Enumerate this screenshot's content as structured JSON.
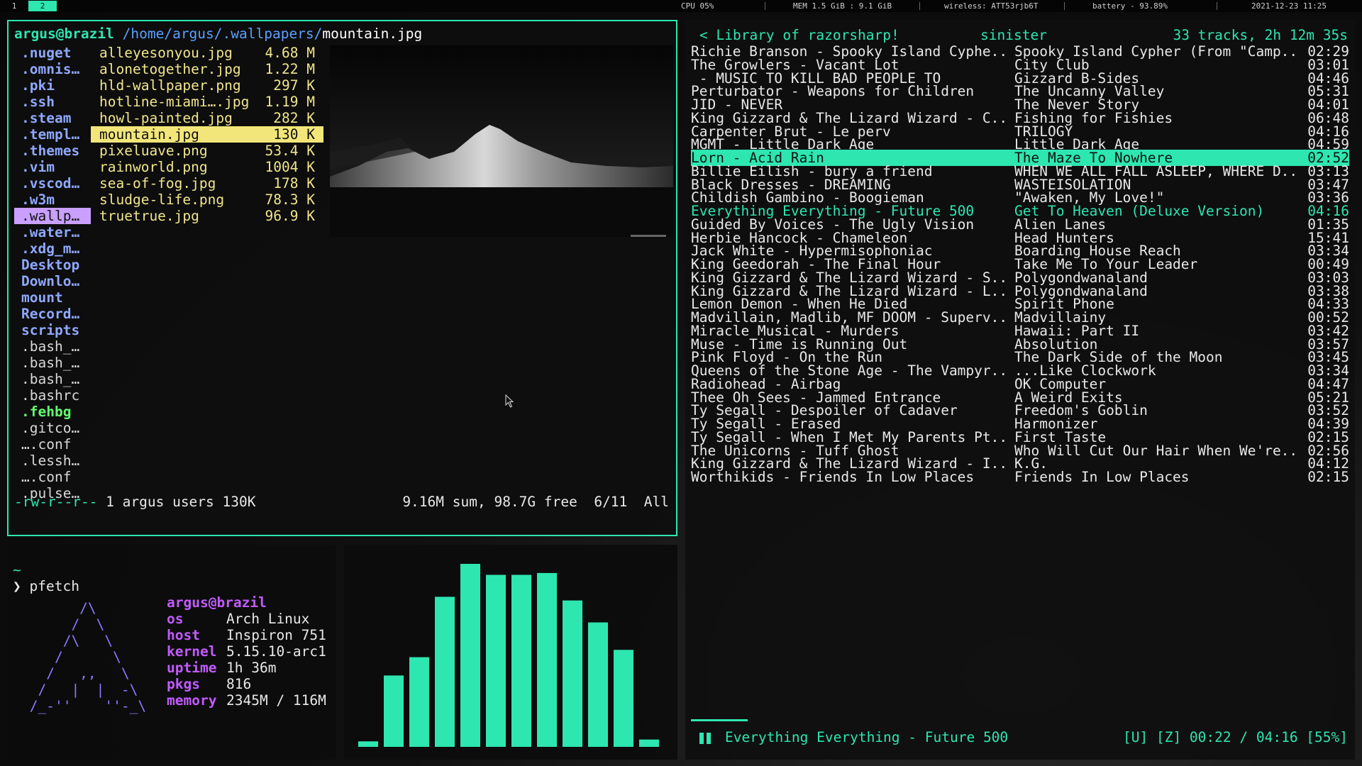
{
  "statusbar": {
    "workspaces": [
      "1",
      "2"
    ],
    "active_workspace": "2",
    "cpu": "CPU 05%",
    "mem": "MEM 1.5 GiB : 9.1 GiB",
    "wireless": "wireless: ATT53rjb6T",
    "battery": "battery - 93.89%",
    "datetime": "2021-12-23 11:25"
  },
  "ranger": {
    "user": "argus@brazil",
    "dir": "/home/argus/.wallpapers/",
    "file": "mountain.jpg",
    "left_entries": [
      {
        "name": ".nuget",
        "kind": "dir"
      },
      {
        "name": ".omnis…",
        "kind": "dir"
      },
      {
        "name": ".pki",
        "kind": "dir"
      },
      {
        "name": ".ssh",
        "kind": "dir"
      },
      {
        "name": ".steam",
        "kind": "dir"
      },
      {
        "name": ".templ…",
        "kind": "dir"
      },
      {
        "name": ".themes",
        "kind": "dir"
      },
      {
        "name": ".vim",
        "kind": "dir"
      },
      {
        "name": ".vscod…",
        "kind": "dir"
      },
      {
        "name": ".w3m",
        "kind": "dir"
      },
      {
        "name": ".wallp…",
        "kind": "sel"
      },
      {
        "name": ".water…",
        "kind": "dir"
      },
      {
        "name": ".xdg_m…",
        "kind": "dir"
      },
      {
        "name": "Desktop",
        "kind": "dir"
      },
      {
        "name": "Downlo…",
        "kind": "dir"
      },
      {
        "name": "mount",
        "kind": "dir"
      },
      {
        "name": "Record…",
        "kind": "dir"
      },
      {
        "name": "scripts",
        "kind": "dir"
      },
      {
        "name": ".bash_…",
        "kind": "file"
      },
      {
        "name": ".bash_…",
        "kind": "file"
      },
      {
        "name": ".bash_…",
        "kind": "file"
      },
      {
        "name": ".bashrc",
        "kind": "file"
      },
      {
        "name": ".fehbg",
        "kind": "exec"
      },
      {
        "name": ".gitco…",
        "kind": "file"
      },
      {
        "name": "….conf",
        "kind": "file"
      },
      {
        "name": ".lessh…",
        "kind": "file"
      },
      {
        "name": "….conf",
        "kind": "file"
      },
      {
        "name": ".pulse…",
        "kind": "file"
      }
    ],
    "files": [
      {
        "name": "alleyesonyou.jpg",
        "size": "4.68 M"
      },
      {
        "name": "alonetogether.jpg",
        "size": "1.22 M"
      },
      {
        "name": "hld-wallpaper.png",
        "size": "297 K"
      },
      {
        "name": "hotline-miami….jpg",
        "size": "1.19 M"
      },
      {
        "name": "howl-painted.jpg",
        "size": "282 K"
      },
      {
        "name": "mountain.jpg",
        "size": "130 K",
        "selected": true
      },
      {
        "name": "pixeluave.png",
        "size": "53.4 K"
      },
      {
        "name": "rainworld.png",
        "size": "1004 K"
      },
      {
        "name": "sea-of-fog.jpg",
        "size": "178 K"
      },
      {
        "name": "sludge-life.png",
        "size": "78.3 K"
      },
      {
        "name": "truetrue.jpg",
        "size": "96.9 K"
      }
    ],
    "perms": "-rw-r--r--",
    "owner": "1 argus users 130K",
    "summary": "9.16M sum, 98.7G free  6/11  All"
  },
  "cmus": {
    "header_left": "< Library of razorsharp!",
    "header_mid": "sinister",
    "header_right": "33 tracks, 2h 12m 35s",
    "tracks": [
      {
        "a": "Richie Branson - Spooky Island Cyphe..",
        "b": "Spooky Island Cypher (From \"Camp..",
        "d": "02:29"
      },
      {
        "a": "The Growlers - Vacant Lot",
        "b": "City Club",
        "d": "03:01"
      },
      {
        "a": " - MUSIC TO KILL BAD PEOPLE TO",
        "b": "Gizzard B-Sides",
        "d": "04:46"
      },
      {
        "a": "Perturbator - Weapons for Children",
        "b": "The Uncanny Valley",
        "d": "05:31"
      },
      {
        "a": "JID - NEVER",
        "b": "The Never Story",
        "d": "04:01"
      },
      {
        "a": "King Gizzard & The Lizard Wizard - C..",
        "b": "Fishing for Fishies",
        "d": "06:48"
      },
      {
        "a": "Carpenter Brut - Le perv",
        "b": "TRILOGY",
        "d": "04:16"
      },
      {
        "a": "MGMT - Little Dark Age",
        "b": "Little Dark Age",
        "d": "04:59"
      },
      {
        "a": "Lorn - Acid Rain",
        "b": "The Maze To Nowhere",
        "d": "02:52",
        "state": "sel"
      },
      {
        "a": "Billie Eilish - bury a friend",
        "b": "WHEN WE ALL FALL ASLEEP, WHERE D..",
        "d": "03:13"
      },
      {
        "a": "Black Dresses - DREAMING",
        "b": "WASTEISOLATION",
        "d": "03:47"
      },
      {
        "a": "Childish Gambino - Boogieman",
        "b": "\"Awaken, My Love!\"",
        "d": "03:36"
      },
      {
        "a": "Everything Everything - Future 500",
        "b": "Get To Heaven (Deluxe Version)",
        "d": "04:16",
        "state": "playing"
      },
      {
        "a": "Guided By Voices - The Ugly Vision",
        "b": "Alien Lanes",
        "d": "01:35"
      },
      {
        "a": "Herbie Hancock - Chameleon",
        "b": "Head Hunters",
        "d": "15:41"
      },
      {
        "a": "Jack White - Hypermisophoniac",
        "b": "Boarding House Reach",
        "d": "03:34"
      },
      {
        "a": "King Geedorah - The Final Hour",
        "b": "Take Me To Your Leader",
        "d": "00:49"
      },
      {
        "a": "King Gizzard & The Lizard Wizard - S..",
        "b": "Polygondwanaland",
        "d": "03:03"
      },
      {
        "a": "King Gizzard & The Lizard Wizard - L..",
        "b": "Polygondwanaland",
        "d": "03:38"
      },
      {
        "a": "Lemon Demon - When He Died",
        "b": "Spirit Phone",
        "d": "04:33"
      },
      {
        "a": "Madvillain, Madlib, MF DOOM - Superv..",
        "b": "Madvillainy",
        "d": "00:52"
      },
      {
        "a": "Miracle Musical - Murders",
        "b": "Hawaii: Part II",
        "d": "03:42"
      },
      {
        "a": "Muse - Time is Running Out",
        "b": "Absolution",
        "d": "03:57"
      },
      {
        "a": "Pink Floyd - On the Run",
        "b": "The Dark Side of the Moon",
        "d": "03:45"
      },
      {
        "a": "Queens of the Stone Age - The Vampyr..",
        "b": "...Like Clockwork",
        "d": "03:34"
      },
      {
        "a": "Radiohead - Airbag",
        "b": "OK Computer",
        "d": "04:47"
      },
      {
        "a": "Thee Oh Sees - Jammed Entrance",
        "b": "A Weird Exits",
        "d": "05:21"
      },
      {
        "a": "Ty Segall - Despoiler of Cadaver",
        "b": "Freedom's Goblin",
        "d": "03:52"
      },
      {
        "a": "Ty Segall - Erased",
        "b": "Harmonizer",
        "d": "04:39"
      },
      {
        "a": "Ty Segall - When I Met My Parents Pt..",
        "b": "First Taste",
        "d": "02:15"
      },
      {
        "a": "The Unicorns - Tuff Ghost",
        "b": "Who Will Cut Our Hair When We're..",
        "d": "02:56"
      },
      {
        "a": "King Gizzard & The Lizard Wizard - I..",
        "b": "K.G.",
        "d": "04:12"
      },
      {
        "a": "Worthikids - Friends In Low Places",
        "b": "Friends In Low Places",
        "d": "02:15"
      }
    ],
    "now_playing": "Everything Everything - Future 500",
    "playback": "[U] [Z] 00:22 / 04:16 [55%]",
    "progress_fraction": 0.086
  },
  "terminal": {
    "tilde": "~",
    "prompt_symbol": "❯",
    "command": "pfetch",
    "user": "argus@brazil",
    "info": [
      {
        "key": "os",
        "value": "Arch Linux"
      },
      {
        "key": "host",
        "value": "Inspiron 751"
      },
      {
        "key": "kernel",
        "value": "5.15.10-arc1"
      },
      {
        "key": "uptime",
        "value": "1h 36m"
      },
      {
        "key": "pkgs",
        "value": "816"
      },
      {
        "key": "memory",
        "value": "2345M / 116M"
      }
    ],
    "art_lines": [
      "       /\\",
      "      /  \\",
      "     /\\   \\",
      "    /      \\",
      "   /   ,,   \\",
      "  /   |  |  -\\",
      " /_-''    ''-_\\"
    ]
  },
  "visualizer": {
    "color": "#2ee6b0",
    "levels": [
      0.03,
      0.39,
      0.49,
      0.82,
      1.0,
      0.94,
      0.94,
      0.95,
      0.8,
      0.68,
      0.53,
      0.04
    ]
  }
}
